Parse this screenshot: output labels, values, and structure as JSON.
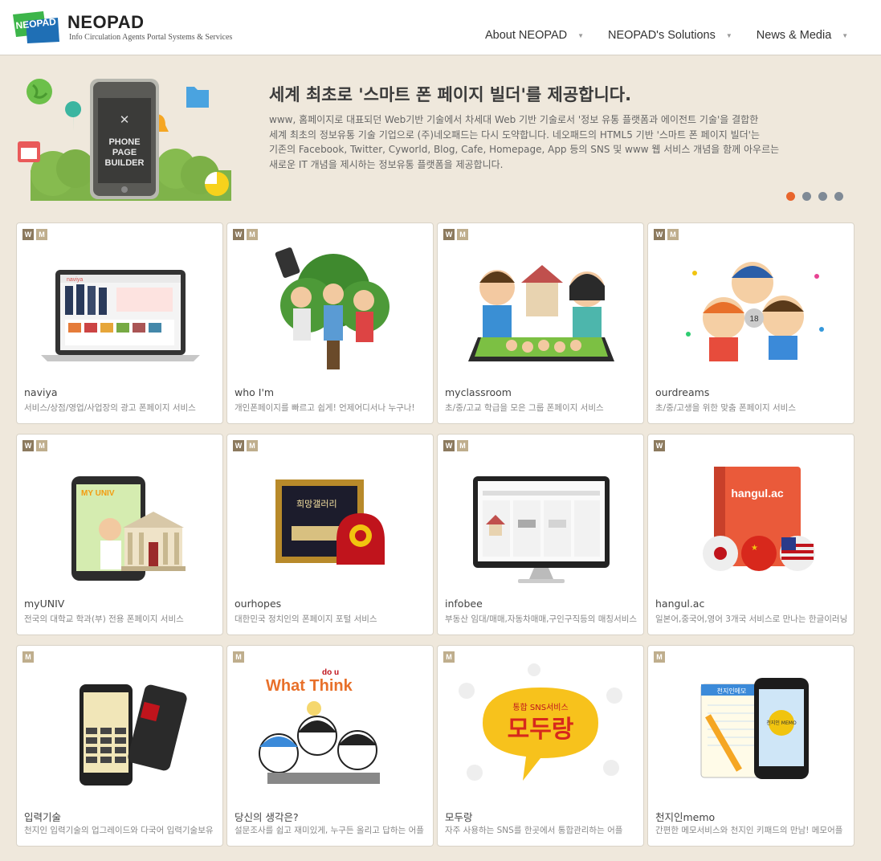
{
  "header": {
    "logo_text": "NEOPAD",
    "brand": "NEOPAD",
    "tagline": "Info Circulation Agents Portal Systems & Services",
    "nav": [
      {
        "label": "About NEOPAD"
      },
      {
        "label": "NEOPAD's Solutions"
      },
      {
        "label": "News & Media"
      }
    ],
    "nav_caret_icon": "caret-down-icon"
  },
  "banner": {
    "title": "세계 최초로 '스마트 폰 페이지 빌더'를 제공합니다.",
    "description_lines": [
      "www, 홈페이지로 대표되던 Web기반 기술에서 차세대 Web 기반 기술로서 '정보 유통 플랫폼과 에이전트 기술'을 결합한",
      "세계 최초의 정보유통 기술 기업으로 (주)네오패드는 다시 도약합니다. 네오패드의 HTML5 기반 '스마트 폰 페이지 빌더'는",
      "기존의 Facebook, Twitter, Cyworld, Blog, Cafe, Homepage, App 등의 SNS 및 www 웹 서비스 개념을 함께 아우르는",
      "새로운 IT 개념을 제시하는 정보유통 플랫폼을 제공합니다."
    ],
    "phone_screen_text": [
      "PHONE",
      "PAGE",
      "BUILDER"
    ],
    "slides": 4,
    "active_slide": 0,
    "active_dot_color": "#e8652d",
    "dot_color": "#7f8a96"
  },
  "badge_labels": {
    "w": "W",
    "m": "M"
  },
  "services": [
    {
      "title": "naviya",
      "desc": "서비스/상점/영업/사업장의 광고 폰페이지 서비스",
      "badges": [
        "w",
        "m"
      ],
      "image": "laptop-website-icon"
    },
    {
      "title": "who I'm",
      "desc": "개인폰페이지를 빠르고 쉽게! 언제어디서나 누구나!",
      "badges": [
        "w",
        "m"
      ],
      "image": "people-tree-icon"
    },
    {
      "title": "myclassroom",
      "desc": "초/중/고교 학급을 모은 그룹 폰페이지 서비스",
      "badges": [
        "w",
        "m"
      ],
      "image": "students-school-tablet-icon"
    },
    {
      "title": "ourdreams",
      "desc": "초/중/고생을 위한 맞춤 폰페이지 서비스",
      "badges": [
        "w",
        "m"
      ],
      "image": "kids-dreams-icon"
    },
    {
      "title": "myUNIV",
      "desc": "전국의 대학교 학과(부) 전용 폰페이지 서비스",
      "badges": [
        "w",
        "m"
      ],
      "image": "tablet-university-icon"
    },
    {
      "title": "ourhopes",
      "desc": "대한민국 정치인의 폰페이지 포털 서비스",
      "badges": [
        "w",
        "m"
      ],
      "image": "framed-picture-chair-icon"
    },
    {
      "title": "infobee",
      "desc": "부동산 임대/매매,자동차매매,구인구직등의 매칭서비스",
      "badges": [
        "w",
        "m"
      ],
      "image": "monitor-listings-icon"
    },
    {
      "title": "hangul.ac",
      "desc": "일본어,중국어,영어 3개국 서비스로 만나는 한글이러닝",
      "badges": [
        "w"
      ],
      "image": "book-flags-icon"
    },
    {
      "title": "입력기술",
      "desc": "천지인 입력기술의 업그레이드와 다국어 입력기술보유",
      "badges": [
        "m"
      ],
      "image": "phones-keypad-icon"
    },
    {
      "title": "당신의 생각은?",
      "desc": "설문조사를 쉽고 재미있게, 누구든 올리고 답하는 어플",
      "badges": [
        "m"
      ],
      "image": "what-do-u-think-icon"
    },
    {
      "title": "모두랑",
      "desc": "자주 사용하는 SNS를 한곳에서 통합관리하는 어플",
      "badges": [
        "m"
      ],
      "image": "sns-bubble-icon"
    },
    {
      "title": "천지인memo",
      "desc": "간편한 메모서비스와 천지인 키패드의 만남! 메모어플",
      "badges": [
        "m"
      ],
      "image": "phone-notepad-icon"
    }
  ],
  "art_text": {
    "what_think": "What Think",
    "do_u": "do u",
    "sns_small": "통합 SNS서비스",
    "sns_big": "모두랑",
    "hangul_book": "hangul.ac",
    "naviya_logo": "naviya",
    "memo_tag": "천지인 MEMO",
    "memo_pad": "천지인메모"
  }
}
